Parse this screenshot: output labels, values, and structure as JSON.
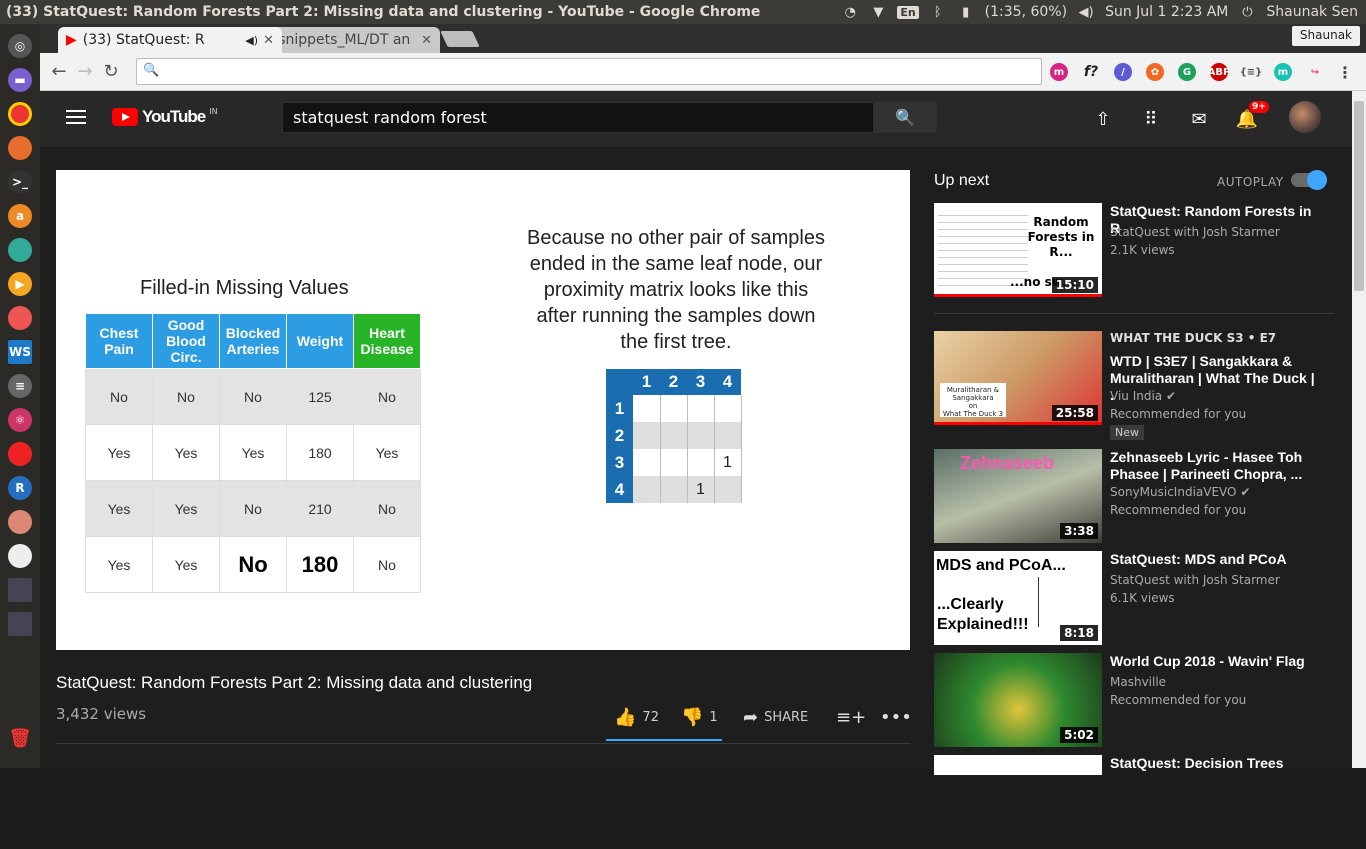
{
  "os": {
    "window_title": "(33) StatQuest: Random Forests Part 2: Missing data and clustering - YouTube - Google Chrome",
    "battery": "(1:35, 60%)",
    "clock": "Sun Jul  1  2:23 AM",
    "user": "Shaunak Sen",
    "keyboard": "En"
  },
  "browser": {
    "tabs": [
      {
        "label": "(33) StatQuest: R",
        "active": true
      },
      {
        "label": "snippets_ML/DT an",
        "active": false
      }
    ],
    "profile": "Shaunak",
    "url": ""
  },
  "youtube": {
    "logo": "YouTube",
    "country": "IN",
    "search_value": "statquest random forest",
    "notifications": "9+"
  },
  "video": {
    "title": "StatQuest: Random Forests Part 2: Missing data and clustering",
    "views": "3,432 views",
    "likes": "72",
    "dislikes": "1",
    "share": "SHARE"
  },
  "slide": {
    "table_title": "Filled-in Missing Values",
    "headers": [
      "Chest Pain",
      "Good Blood Circ.",
      "Blocked Arteries",
      "Weight",
      "Heart Disease"
    ],
    "rows": [
      [
        "No",
        "No",
        "No",
        "125",
        "No"
      ],
      [
        "Yes",
        "Yes",
        "Yes",
        "180",
        "Yes"
      ],
      [
        "Yes",
        "Yes",
        "No",
        "210",
        "No"
      ],
      [
        "Yes",
        "Yes",
        "No",
        "180",
        "No"
      ]
    ],
    "text": "Because no other pair of samples ended in the same leaf node, our proximity matrix looks like this after running the samples down the first tree.",
    "matrix_labels": [
      "1",
      "2",
      "3",
      "4"
    ],
    "matrix": [
      [
        "",
        "",
        "",
        ""
      ],
      [
        "",
        "",
        "",
        ""
      ],
      [
        "",
        "",
        "",
        "1"
      ],
      [
        "",
        "",
        "1",
        ""
      ]
    ]
  },
  "sidebar": {
    "up_next": "Up next",
    "autoplay": "AUTOPLAY",
    "items": [
      {
        "title": "StatQuest: Random Forests in R",
        "channel": "StatQuest with Josh Starmer",
        "meta": "2.1K views",
        "duration": "15:10",
        "thumb_text": "Random Forests in R...",
        "thumb_text2": "...no sw..."
      },
      {
        "kicker": "WHAT THE DUCK  S3 • E7",
        "title": "WTD | S3E7 | Sangakkara & Muralitharan | What The Duck |  .",
        "channel": "Viu India",
        "meta": "Recommended for you",
        "badge": "New",
        "duration": "25:58"
      },
      {
        "title": "Zehnaseeb Lyric - Hasee Toh Phasee | Parineeti Chopra,  ...",
        "channel": "SonyMusicIndiaVEVO",
        "meta": "Recommended for you",
        "duration": "3:38",
        "thumb_text": "Zehnaseeb"
      },
      {
        "title": "StatQuest: MDS and PCoA",
        "channel": "StatQuest with Josh Starmer",
        "meta": "6.1K views",
        "duration": "8:18",
        "thumb_text": "MDS and PCoA...",
        "thumb_text2": "...Clearly Explained!!!"
      },
      {
        "title": "World Cup 2018 - Wavin' Flag",
        "channel": "Mashville",
        "meta": "Recommended for you",
        "duration": "5:02"
      },
      {
        "title": "StatQuest: Decision Trees"
      }
    ]
  },
  "colors": {
    "accent": "#3ea6ff",
    "youtube_red": "#ff0000",
    "table_header": "#2c9de2",
    "heart_header": "#27b427",
    "matrix_header": "#1a6eaf"
  }
}
